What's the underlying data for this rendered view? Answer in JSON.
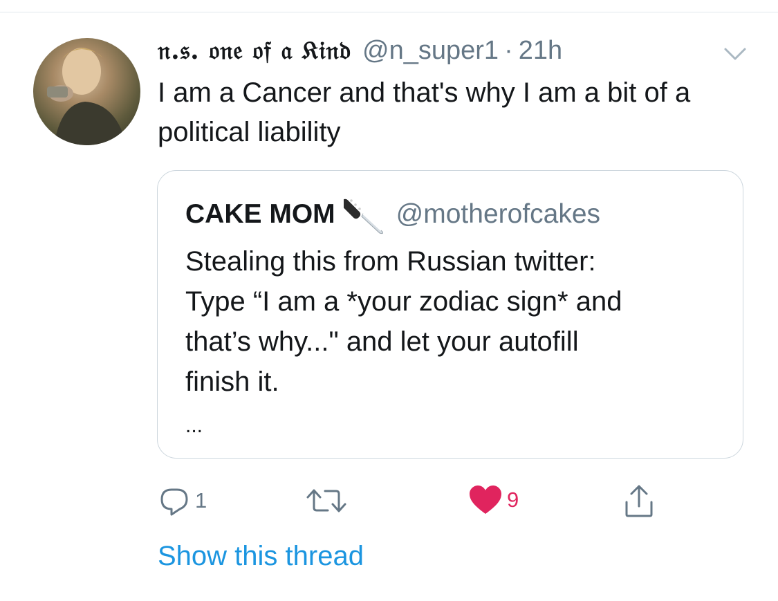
{
  "tweet": {
    "display_name": "𝔫.𝔰. 𝔬𝔫𝔢 𝔬𝔣 𝔞 𝔎𝔦𝔫𝔡",
    "handle": "@n_super1",
    "separator": "·",
    "time": "21h",
    "text": "I am a Cancer and that's why I am a bit of a political liability",
    "avatar_icon": "profile-photo",
    "menu_icon": "chevron-down-icon"
  },
  "quote": {
    "name": "CAKE MOM",
    "name_emoji": "knife-emoji",
    "handle": "@motherofcakes",
    "text_lines": [
      "Stealing this from Russian twitter:",
      "Type “I am a *your zodiac sign* and",
      "that’s why...\" and let your autofill",
      "finish it."
    ],
    "ellipsis": "..."
  },
  "actions": {
    "reply_count": "1",
    "retweet_count": "",
    "like_count": "9",
    "liked": true,
    "share_icon": "share-icon",
    "like_color": "#e0245e",
    "icon_color": "#657786"
  },
  "show_thread": "Show this thread",
  "colors": {
    "link": "#1b95e0",
    "text": "#14171a",
    "secondary": "#657786",
    "border": "#ccd6dd"
  }
}
